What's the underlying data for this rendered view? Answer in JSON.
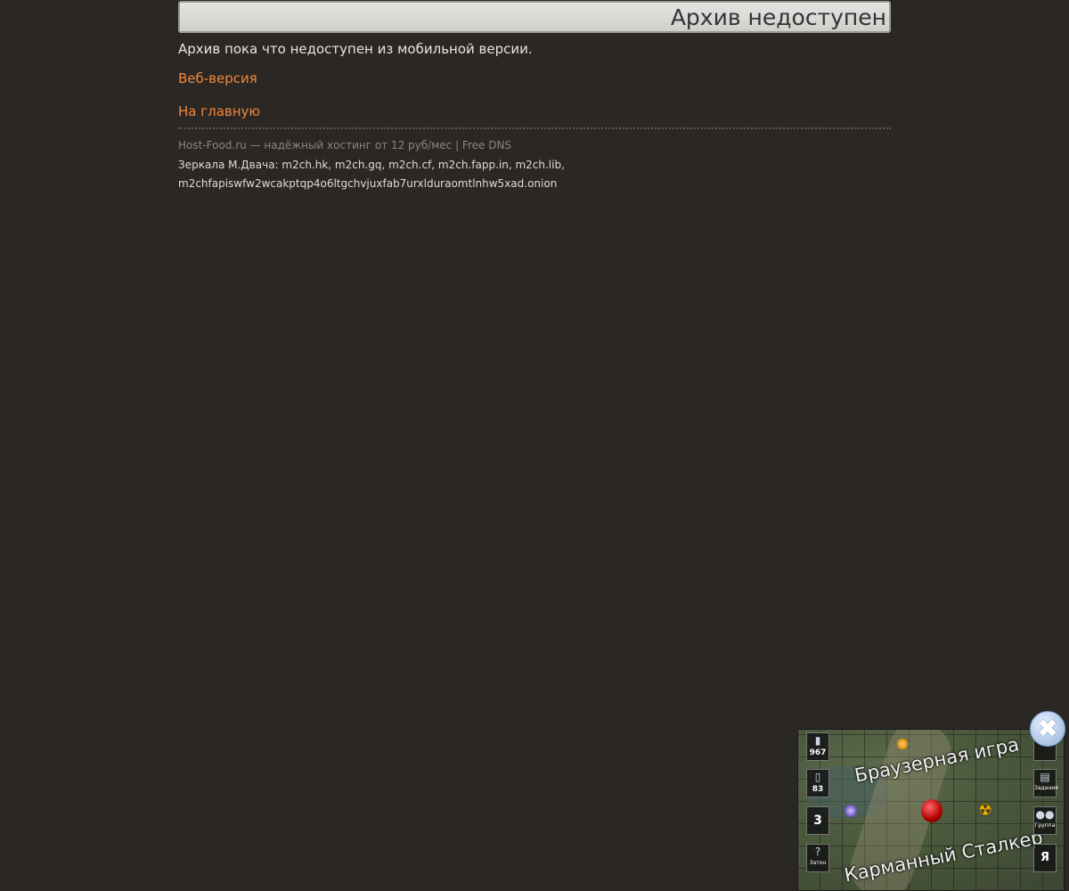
{
  "header": {
    "title": "Архив недоступен"
  },
  "main": {
    "notice": "Архив пока что недоступен из мобильной версии.",
    "web_version_link": "Веб-версия",
    "home_link": "На главную"
  },
  "footer": {
    "hosting": "Host-Food.ru — надёжный хостинг от 12 руб/мес | Free DNS",
    "mirrors_line1": "Зеркала М.Двача: m2ch.hk, m2ch.gq, m2ch.cf, m2ch.fapp.in, m2ch.lib,",
    "mirrors_line2": "m2chfapiswfw2wcakptqp4o6ltgchvjuxfab7urxlduraomtlnhw5xad.onion"
  },
  "banner": {
    "text_top": "Браузерная игра",
    "text_bottom": "Карманный Сталкер",
    "left_slots": [
      {
        "icon": "flashlight-icon",
        "value": "967"
      },
      {
        "icon": "flask-icon",
        "value": "83"
      },
      {
        "icon": "level-icon",
        "value": "3"
      },
      {
        "icon": "question-icon",
        "value": "?",
        "label": "Затон"
      }
    ],
    "right_slots": [
      {
        "icon": "flag-icon",
        "label": ""
      },
      {
        "icon": "map-icon",
        "label": "Задания"
      },
      {
        "icon": "group-icon",
        "label": "Группа"
      },
      {
        "icon": "profile-icon",
        "value": "Я"
      }
    ]
  },
  "colors": {
    "background": "#2a2724",
    "link": "#f0883c",
    "text": "#e6e6e6",
    "muted": "#8a8580"
  }
}
